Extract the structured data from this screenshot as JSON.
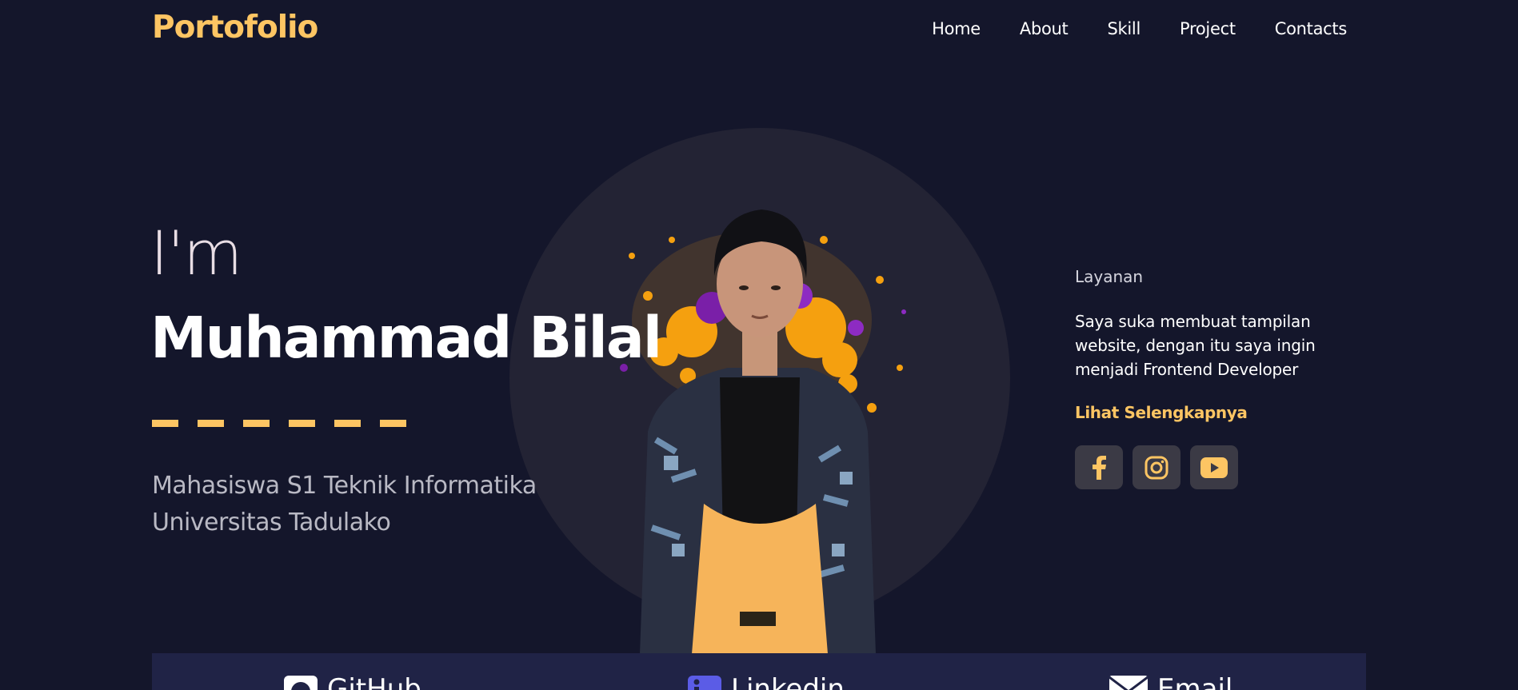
{
  "header": {
    "logo": "Portofolio",
    "nav": [
      "Home",
      "About",
      "Skill",
      "Project",
      "Contacts"
    ]
  },
  "hero": {
    "greeting": "I'm",
    "name": "Muhammad Bilal",
    "subtitle_line1": "Mahasiswa S1 Teknik Informatika",
    "subtitle_line2": "Universitas Tadulako"
  },
  "service": {
    "title": "Layanan",
    "description": "Saya suka membuat tampilan website, dengan itu saya ingin menjadi Frontend Developer",
    "link": "Lihat Selengkapnya",
    "socials": [
      "facebook-icon",
      "instagram-icon",
      "youtube-icon"
    ]
  },
  "contacts": {
    "items": [
      {
        "label": "GitHub",
        "icon": "github-icon"
      },
      {
        "label": "Linkedin",
        "icon": "linkedin-icon"
      },
      {
        "label": "Email",
        "icon": "email-icon"
      }
    ]
  },
  "colors": {
    "background": "#14162b",
    "accent": "#fdc563",
    "circle": "#232334",
    "contact_bar": "#202346",
    "social_button": "#3b3a45"
  }
}
